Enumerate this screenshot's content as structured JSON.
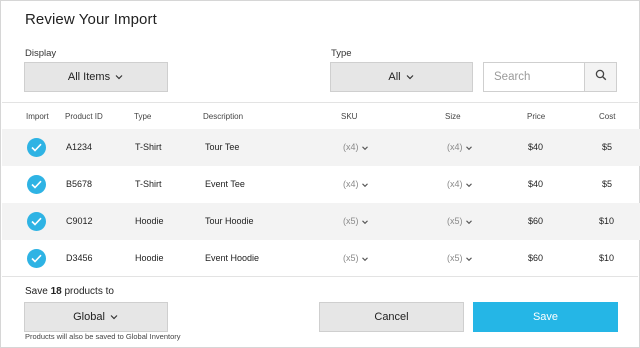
{
  "page": {
    "title": "Review Your Import"
  },
  "filters": {
    "display_label": "Display",
    "display_value": "All Items",
    "type_label": "Type",
    "type_value": "All",
    "search_placeholder": "Search"
  },
  "table": {
    "columns": [
      "Import",
      "Product ID",
      "Type",
      "Description",
      "SKU",
      "Size",
      "Price",
      "Cost"
    ],
    "rows": [
      {
        "checked": true,
        "product_id": "A1234",
        "type": "T-Shirt",
        "description": "Tour Tee",
        "sku": "(x4)",
        "size": "(x4)",
        "price": "$40",
        "cost": "$5"
      },
      {
        "checked": true,
        "product_id": "B5678",
        "type": "T-Shirt",
        "description": "Event Tee",
        "sku": "(x4)",
        "size": "(x4)",
        "price": "$40",
        "cost": "$5"
      },
      {
        "checked": true,
        "product_id": "C9012",
        "type": "Hoodie",
        "description": "Tour Hoodie",
        "sku": "(x5)",
        "size": "(x5)",
        "price": "$60",
        "cost": "$10"
      },
      {
        "checked": true,
        "product_id": "D3456",
        "type": "Hoodie",
        "description": "Event Hoodie",
        "sku": "(x5)",
        "size": "(x5)",
        "price": "$60",
        "cost": "$10"
      }
    ]
  },
  "footer": {
    "save_prefix": "Save",
    "save_count": "18",
    "save_suffix": "products to",
    "destination_value": "Global",
    "note": "Products will also be saved to Global Inventory",
    "cancel_label": "Cancel",
    "save_label": "Save"
  },
  "colors": {
    "accent": "#25b6e6",
    "button_gray": "#e6e6e6",
    "row_shade": "#f3f3f3"
  }
}
